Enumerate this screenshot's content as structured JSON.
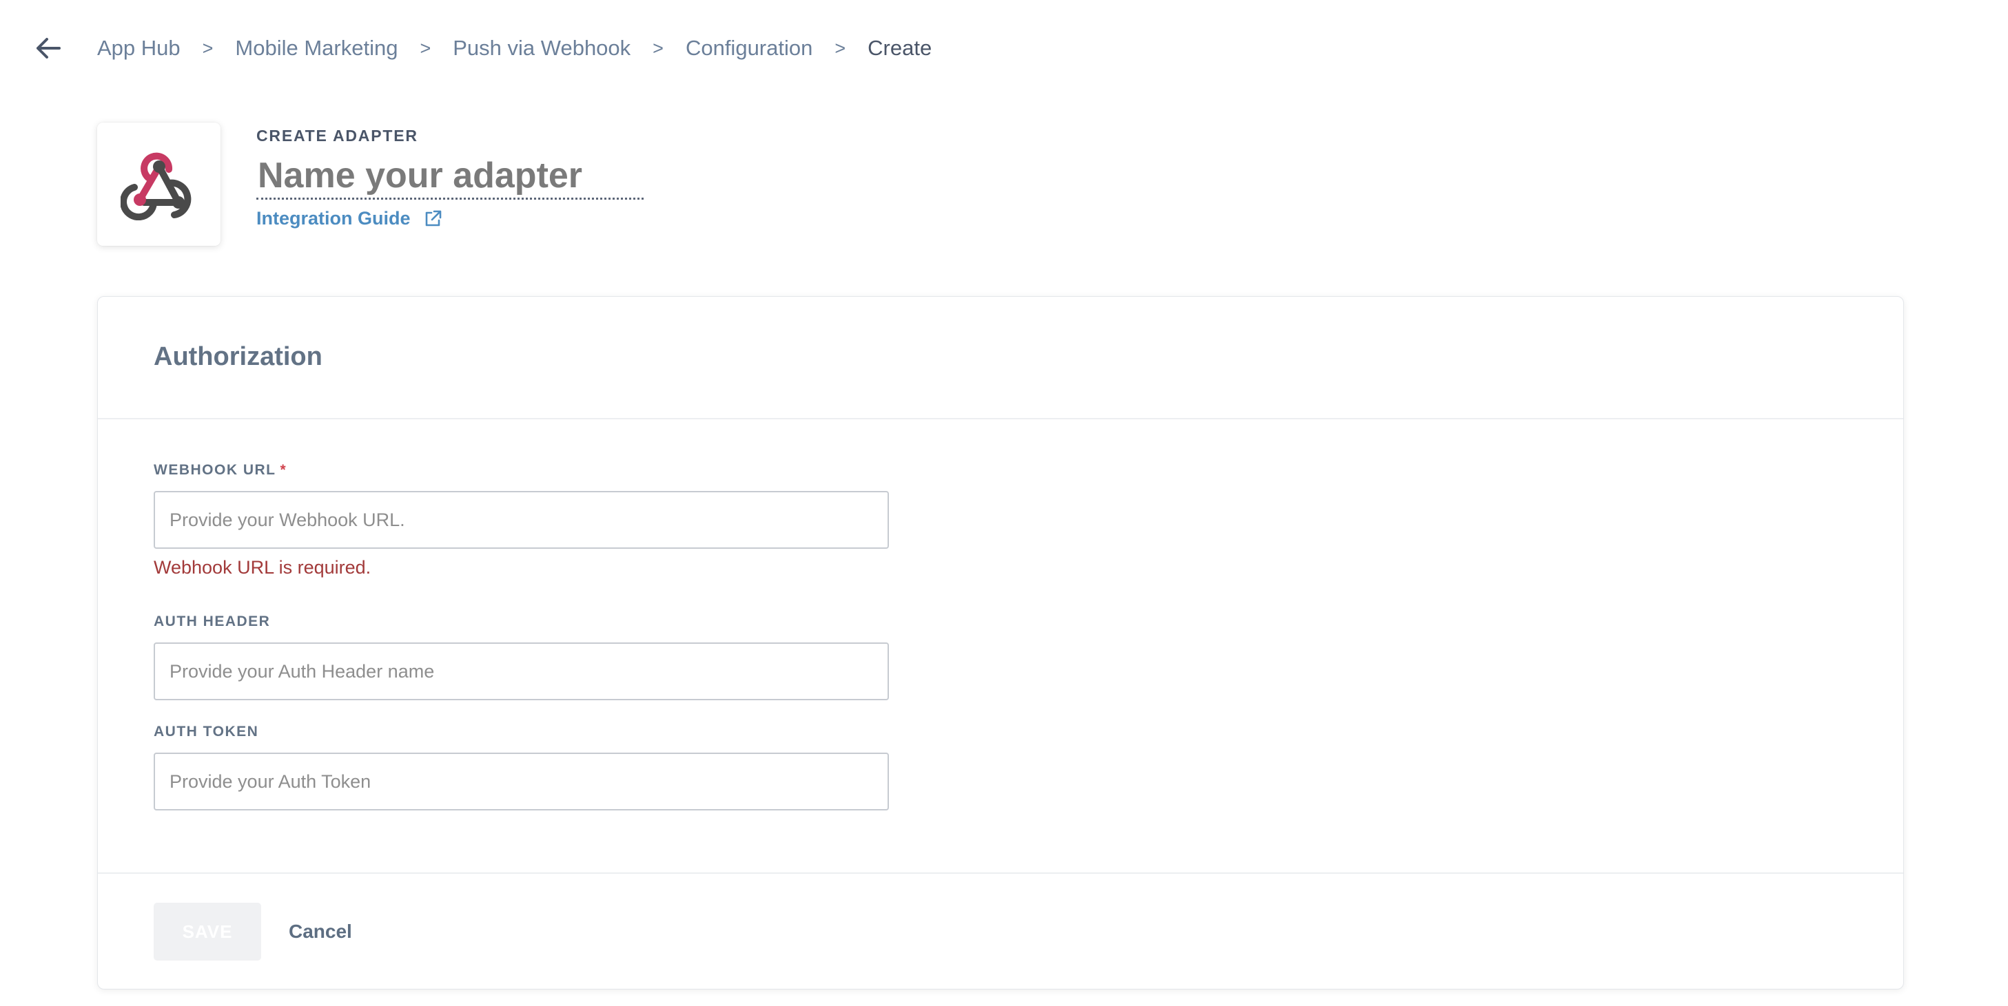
{
  "nav": {
    "back_icon": "arrow-left-icon",
    "breadcrumb": [
      {
        "label": "App Hub"
      },
      {
        "label": "Mobile Marketing"
      },
      {
        "label": "Push via Webhook"
      },
      {
        "label": "Configuration"
      },
      {
        "label": "Create"
      }
    ],
    "separator": ">"
  },
  "header": {
    "logo_icon": "webhook-logo-icon",
    "eyebrow": "CREATE ADAPTER",
    "name_placeholder": "Name your adapter",
    "name_value": "",
    "guide_label": "Integration Guide",
    "guide_icon": "external-link-icon"
  },
  "card": {
    "title": "Authorization",
    "fields": {
      "webhook_url": {
        "label": "WEBHOOK URL",
        "required_marker": "*",
        "placeholder": "Provide your Webhook URL.",
        "value": "",
        "error": "Webhook URL is required."
      },
      "auth_header": {
        "label": "AUTH HEADER",
        "placeholder": "Provide your Auth Header name",
        "value": ""
      },
      "auth_token": {
        "label": "AUTH TOKEN",
        "placeholder": "Provide your Auth Token",
        "value": ""
      }
    },
    "actions": {
      "save_label": "SAVE",
      "cancel_label": "Cancel"
    }
  },
  "colors": {
    "breadcrumb": "#6b7f99",
    "link": "#4c8cc1",
    "error": "#a23a3a",
    "required": "#d0434d",
    "webhook_red": "#c73a63",
    "webhook_dark": "#4a4a4a"
  }
}
